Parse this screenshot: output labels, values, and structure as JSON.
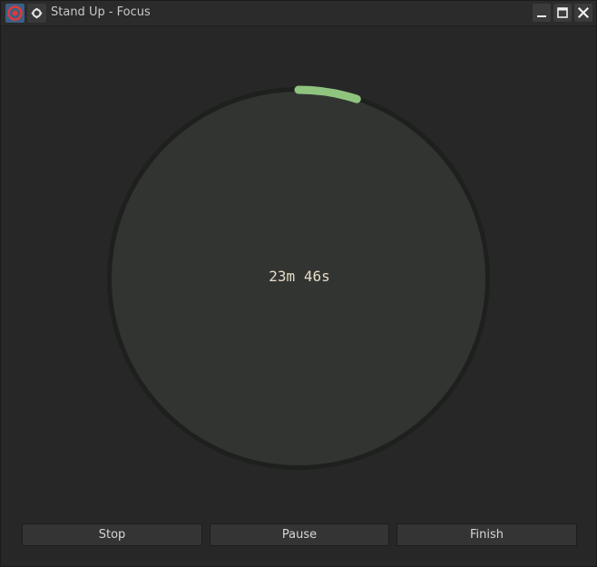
{
  "window": {
    "title": "Stand Up - Focus"
  },
  "icons": {
    "app": "stand-up-app-icon",
    "menu": "window-menu-icon",
    "minimize": "minimize-icon",
    "maximize": "maximize-icon",
    "close": "close-icon"
  },
  "timer": {
    "remaining_label": "23m 46s",
    "elapsed_fraction": 0.05,
    "progress_color": "#8fc47f",
    "ring_color": "#1e201d",
    "face_color": "#323432"
  },
  "buttons": {
    "stop_label": "Stop",
    "pause_label": "Pause",
    "finish_label": "Finish"
  }
}
